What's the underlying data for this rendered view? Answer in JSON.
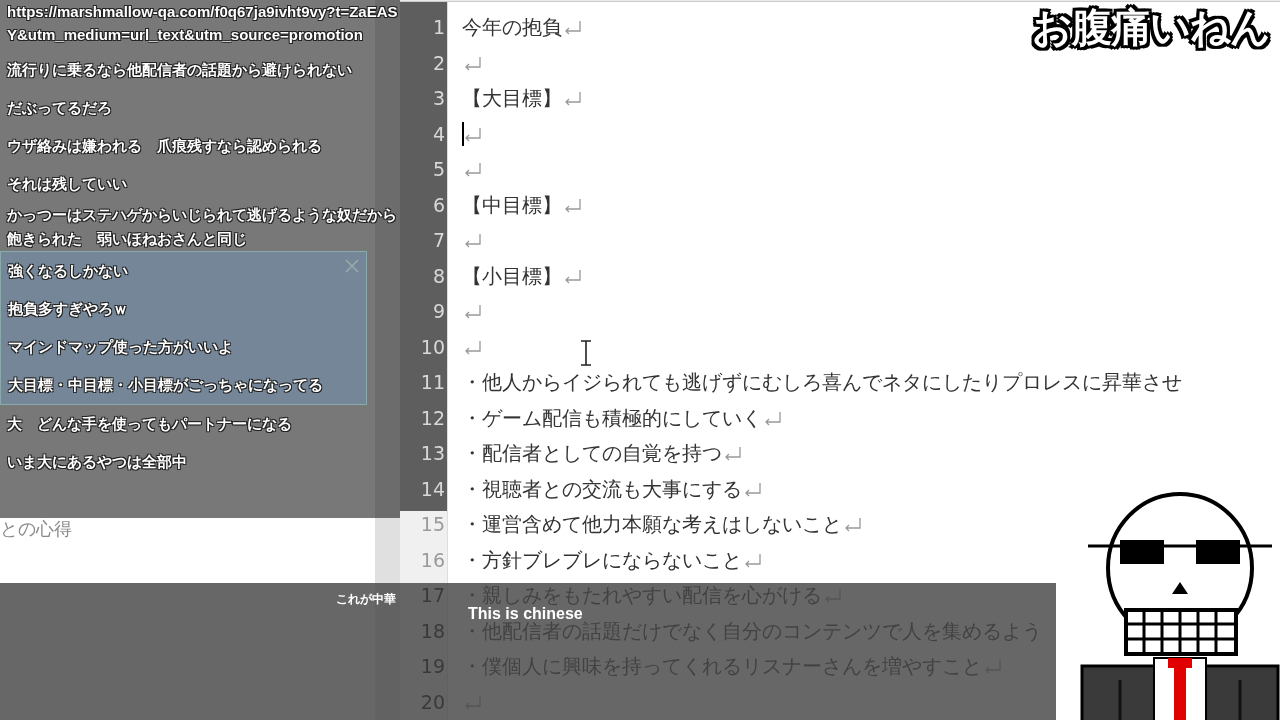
{
  "stream_title": "お腹痛いねん",
  "notes": [
    {
      "title": "との心得"
    }
  ],
  "comments": [
    {
      "text": "https://marshmallow-qa.com/f0q67ja9ivht9vy?t=ZaEASY&utm_medium=url_text&utm_source=promotion",
      "highlighted": false
    },
    {
      "text": "流行りに乗るなら他配信者の話題から避けられない",
      "highlighted": false
    },
    {
      "text": "だぶってるだろ",
      "highlighted": false
    },
    {
      "text": "ウザ絡みは嫌われる　爪痕残すなら認められる",
      "highlighted": false
    },
    {
      "text": "それは残していい",
      "highlighted": false
    },
    {
      "text": "かっつーはステハゲからいじられて逃げるような奴だから飽きられた　弱いほねおさんと同じ",
      "highlighted": false
    },
    {
      "text": "強くなるしかない",
      "highlighted": true
    },
    {
      "text": "抱負多すぎやろｗ",
      "highlighted": true
    },
    {
      "text": "マインドマップ使った方がいいよ",
      "highlighted": true
    },
    {
      "text": "大目標・中目標・小目標がごっちゃになってる",
      "highlighted": true
    },
    {
      "text": "大　どんな手を使ってもパートナーになる",
      "highlighted": false
    },
    {
      "text": "いま大にあるやつは全部中",
      "highlighted": false
    }
  ],
  "editor": {
    "lines": [
      {
        "number": "1",
        "text": "今年の抱負",
        "newline": true,
        "caret": false
      },
      {
        "number": "2",
        "newline": true,
        "caret": false
      },
      {
        "number": "3",
        "text": "【大目標】",
        "newline": true,
        "caret": false
      },
      {
        "number": "4",
        "newline": true,
        "caret": true
      },
      {
        "number": "5",
        "newline": true,
        "caret": false
      },
      {
        "number": "6",
        "text": "【中目標】",
        "newline": true,
        "caret": false
      },
      {
        "number": "7",
        "newline": true,
        "caret": false
      },
      {
        "number": "8",
        "text": "【小目標】",
        "newline": true,
        "caret": false
      },
      {
        "number": "9",
        "newline": true,
        "caret": false
      },
      {
        "number": "10",
        "newline": true,
        "caret": false
      },
      {
        "number": "11",
        "text": "・他人からイジられても逃げずにむしろ喜んでネタにしたりプロレスに昇華させ",
        "newline": false,
        "caret": false
      },
      {
        "number": "12",
        "text": "・ゲーム配信も積極的にしていく",
        "newline": true,
        "caret": false
      },
      {
        "number": "13",
        "text": "・配信者としての自覚を持つ",
        "newline": true,
        "caret": false
      },
      {
        "number": "14",
        "text": "・視聴者との交流も大事にする",
        "newline": true,
        "caret": false
      },
      {
        "number": "15",
        "text": "・運営含めて他力本願な考えはしないこと",
        "newline": true,
        "caret": false
      },
      {
        "number": "16",
        "text": "・方針ブレブレにならないこと",
        "newline": true,
        "caret": false
      },
      {
        "number": "17",
        "text": "・親しみをもたれやすい配信を心がける",
        "newline": true,
        "caret": false
      },
      {
        "number": "18",
        "text": "・他配信者の話題だけでなく自分のコンテンツで人を集めるよう",
        "newline": false,
        "caret": false
      },
      {
        "number": "19",
        "text": "・僕個人に興味を持ってくれるリスナーさんを増やすこと",
        "newline": true,
        "caret": false
      },
      {
        "number": "20",
        "newline": true,
        "caret": false
      }
    ]
  },
  "subtitle": {
    "ruby": "これが中華",
    "text": "This is chinese"
  }
}
